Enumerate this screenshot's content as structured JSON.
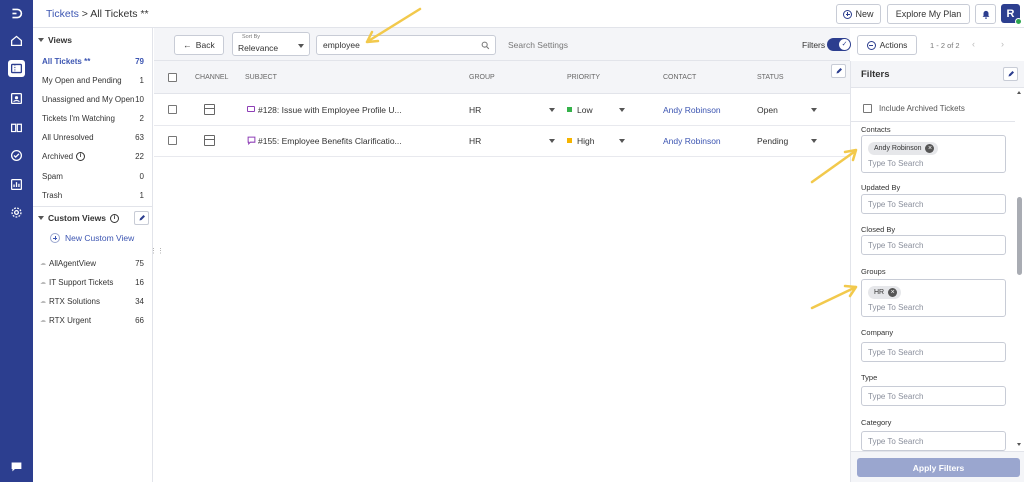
{
  "header": {
    "breadcrumb_root": "Tickets",
    "breadcrumb_sep": ">",
    "breadcrumb_current": "All Tickets **",
    "new_label": "New",
    "plan_label": "Explore My Plan",
    "avatar_initial": "R"
  },
  "views": {
    "title": "Views",
    "items": [
      {
        "label": "All Tickets **",
        "count": "79"
      },
      {
        "label": "My Open and Pending",
        "count": "1"
      },
      {
        "label": "Unassigned and My Open",
        "count": "10"
      },
      {
        "label": "Tickets I'm Watching",
        "count": "2"
      },
      {
        "label": "All Unresolved",
        "count": "63"
      },
      {
        "label": "Archived",
        "count": "22"
      },
      {
        "label": "Spam",
        "count": "0"
      },
      {
        "label": "Trash",
        "count": "1"
      }
    ],
    "custom_title": "Custom Views",
    "new_custom_label": "New Custom View",
    "custom_items": [
      {
        "label": "AllAgentView",
        "count": "75"
      },
      {
        "label": "IT Support Tickets",
        "count": "16"
      },
      {
        "label": "RTX Solutions",
        "count": "34"
      },
      {
        "label": "RTX Urgent",
        "count": "66"
      }
    ]
  },
  "toolbar": {
    "back_label": "Back",
    "sort_caption": "Sort By",
    "sort_value": "Relevance",
    "search_value": "employee",
    "search_settings": "Search Settings",
    "filters_label": "Filters",
    "actions_label": "Actions",
    "pagination": "1 - 2 of 2"
  },
  "table": {
    "columns": [
      "CHANNEL",
      "SUBJECT",
      "GROUP",
      "PRIORITY",
      "CONTACT",
      "STATUS"
    ],
    "rows": [
      {
        "subject": "#128: Issue with Employee Profile U...",
        "group": "HR",
        "priority": "Low",
        "priority_color": "#35b24a",
        "contact": "Andy Robinson",
        "status": "Open"
      },
      {
        "subject": "#155: Employee Benefits Clarificatio...",
        "group": "HR",
        "priority": "High",
        "priority_color": "#f5b400",
        "contact": "Andy Robinson",
        "status": "Pending"
      }
    ]
  },
  "filters": {
    "title": "Filters",
    "archived_label": "Include Archived Tickets",
    "placeholder": "Type To Search",
    "contacts_label": "Contacts",
    "contacts_chip": "Andy Robinson",
    "updated_by_label": "Updated By",
    "closed_by_label": "Closed By",
    "groups_label": "Groups",
    "groups_chip": "HR",
    "company_label": "Company",
    "type_label": "Type",
    "category_label": "Category",
    "apply_label": "Apply Filters"
  },
  "colors": {
    "rail": "#2c3e8f",
    "accent": "#3d56b2",
    "annotation_arrow": "#f2c94c"
  }
}
